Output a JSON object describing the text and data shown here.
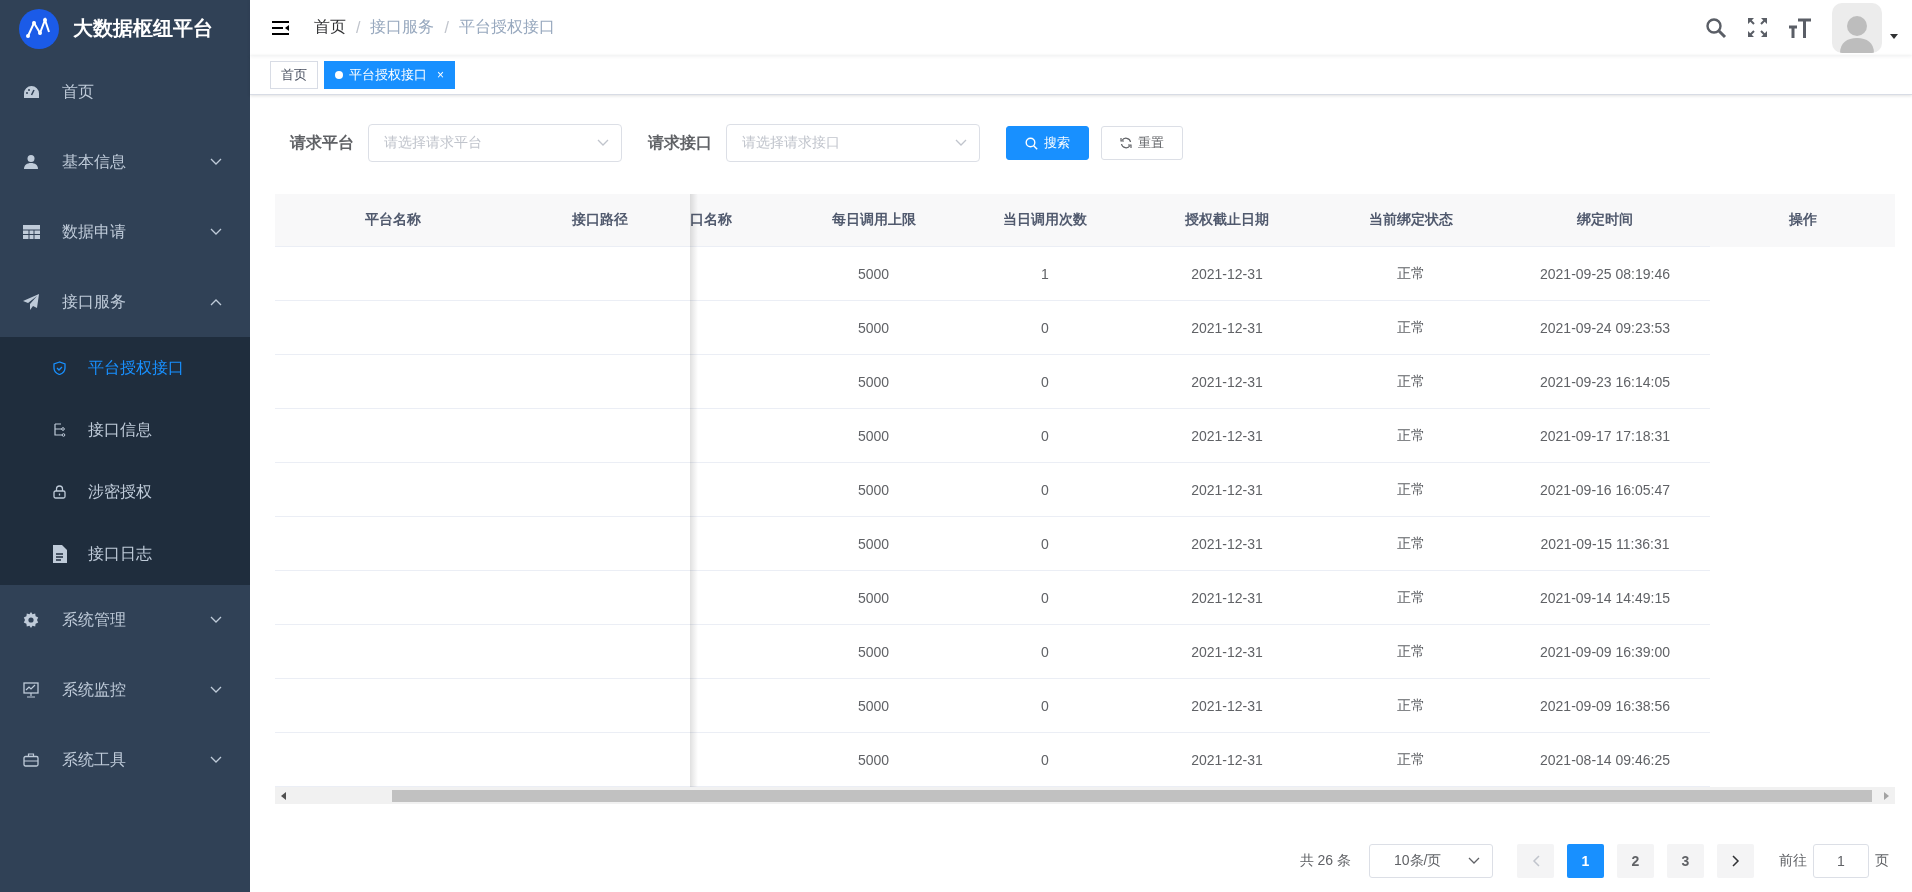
{
  "sidebar": {
    "title": "大数据枢纽平台",
    "items": [
      {
        "label": "首页",
        "kind": "link",
        "selected": false
      },
      {
        "label": "基本信息",
        "kind": "group",
        "expanded": false,
        "selected": false
      },
      {
        "label": "数据申请",
        "kind": "group",
        "expanded": false,
        "selected": false
      },
      {
        "label": "接口服务",
        "kind": "group",
        "expanded": true,
        "selected": false,
        "children": [
          {
            "label": "平台授权接口",
            "selected": true
          },
          {
            "label": "接口信息",
            "selected": false
          },
          {
            "label": "涉密授权",
            "selected": false
          },
          {
            "label": "接口日志",
            "selected": false
          }
        ]
      },
      {
        "label": "系统管理",
        "kind": "group",
        "expanded": false,
        "selected": false
      },
      {
        "label": "系统监控",
        "kind": "group",
        "expanded": false,
        "selected": false
      },
      {
        "label": "系统工具",
        "kind": "group",
        "expanded": false,
        "selected": false
      }
    ]
  },
  "breadcrumb": [
    {
      "label": "首页"
    },
    {
      "separator": "/",
      "label": "接口服务"
    },
    {
      "separator": "/",
      "label": "平台授权接口"
    }
  ],
  "tags": [
    {
      "label": "首页",
      "selected": false
    },
    {
      "label": "平台授权接口",
      "selected": true,
      "close": "×"
    }
  ],
  "filters": [
    {
      "label": "请求平台",
      "placeholder": "请选择请求平台"
    },
    {
      "label": "请求接口",
      "placeholder": "请选择请求接口"
    }
  ],
  "buttons": [
    {
      "kind": "primary",
      "label": "搜索"
    },
    {
      "kind": "default",
      "label": "重置"
    }
  ],
  "table": {
    "columns": [
      {
        "label": "平台名称",
        "kind": "fixed"
      },
      {
        "label": "接口路径",
        "kind": "fixed"
      },
      {
        "label": "口名称",
        "kind": "cut"
      },
      {
        "label": "每日调用上限",
        "kind": "data"
      },
      {
        "label": "当日调用次数",
        "kind": "data"
      },
      {
        "label": "授权截止日期",
        "kind": "data"
      },
      {
        "label": "当前绑定状态",
        "kind": "data"
      },
      {
        "label": "绑定时间",
        "kind": "data"
      },
      {
        "label": "操作",
        "kind": "fixed"
      }
    ],
    "rows": [
      {
        "cells": [
          "",
          "",
          "",
          "5000",
          "1",
          "2021-12-31",
          "正常",
          "2021-09-25 08:19:46",
          ""
        ]
      },
      {
        "cells": [
          "",
          "",
          "",
          "5000",
          "0",
          "2021-12-31",
          "正常",
          "2021-09-24 09:23:53",
          ""
        ]
      },
      {
        "cells": [
          "",
          "",
          "",
          "5000",
          "0",
          "2021-12-31",
          "正常",
          "2021-09-23 16:14:05",
          ""
        ]
      },
      {
        "cells": [
          "",
          "",
          "",
          "5000",
          "0",
          "2021-12-31",
          "正常",
          "2021-09-17 17:18:31",
          ""
        ]
      },
      {
        "cells": [
          "",
          "",
          "",
          "5000",
          "0",
          "2021-12-31",
          "正常",
          "2021-09-16 16:05:47",
          ""
        ]
      },
      {
        "cells": [
          "",
          "",
          "",
          "5000",
          "0",
          "2021-12-31",
          "正常",
          "2021-09-15 11:36:31",
          ""
        ]
      },
      {
        "cells": [
          "",
          "",
          "",
          "5000",
          "0",
          "2021-12-31",
          "正常",
          "2021-09-14 14:49:15",
          ""
        ]
      },
      {
        "cells": [
          "",
          "",
          "",
          "5000",
          "0",
          "2021-12-31",
          "正常",
          "2021-09-09 16:39:00",
          ""
        ]
      },
      {
        "cells": [
          "",
          "",
          "",
          "5000",
          "0",
          "2021-12-31",
          "正常",
          "2021-09-09 16:38:56",
          ""
        ]
      },
      {
        "cells": [
          "",
          "",
          "",
          "5000",
          "0",
          "2021-12-31",
          "正常",
          "2021-08-14 09:46:25",
          ""
        ]
      }
    ]
  },
  "pagination": {
    "total": "共 26 条",
    "page_size": "10条/页",
    "prev_disabled": true,
    "pages": [
      {
        "label": "1",
        "selected": true
      },
      {
        "label": "2",
        "selected": false
      },
      {
        "label": "3",
        "selected": false
      }
    ],
    "goto_label": "前往",
    "goto_value": "1",
    "goto_suffix": "页"
  }
}
